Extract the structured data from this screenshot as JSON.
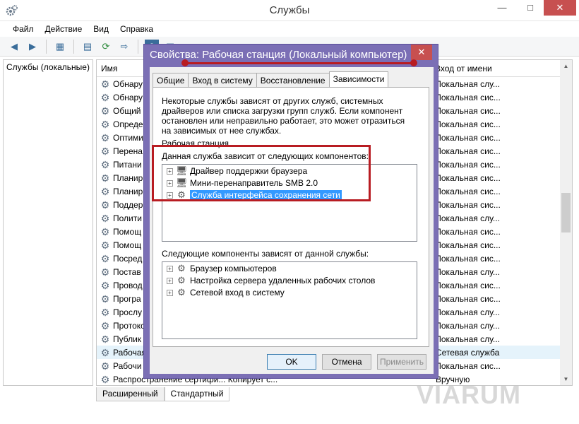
{
  "window": {
    "title": "Службы"
  },
  "menu": [
    "Файл",
    "Действие",
    "Вид",
    "Справка"
  ],
  "tree": {
    "root": "Службы (локальные)"
  },
  "list": {
    "col_name": "Имя",
    "col_logon": "Вход от имени",
    "rows": [
      {
        "name": "Обнару",
        "logon": "Локальная слу..."
      },
      {
        "name": "Обнару",
        "logon": "Локальная сис..."
      },
      {
        "name": "Общий",
        "logon": "Локальная сис..."
      },
      {
        "name": "Опреде",
        "logon": "Локальная сис..."
      },
      {
        "name": "Оптими",
        "logon": "Локальная сис..."
      },
      {
        "name": "Перена",
        "logon": "Локальная сис..."
      },
      {
        "name": "Питани",
        "logon": "Локальная сис..."
      },
      {
        "name": "Планир",
        "logon": "Локальная сис..."
      },
      {
        "name": "Планир",
        "logon": "Локальная сис..."
      },
      {
        "name": "Поддер",
        "logon": "Локальная сис..."
      },
      {
        "name": "Полити",
        "logon": "Локальная слу..."
      },
      {
        "name": "Помощ",
        "logon": "Локальная сис..."
      },
      {
        "name": "Помощ",
        "logon": "Локальная сис..."
      },
      {
        "name": "Посред",
        "logon": "Локальная сис..."
      },
      {
        "name": "Постав",
        "logon": "Локальная слу..."
      },
      {
        "name": "Провод",
        "logon": "Локальная сис..."
      },
      {
        "name": "Програ",
        "logon": "Локальная сис..."
      },
      {
        "name": "Прослу",
        "logon": "Локальная слу..."
      },
      {
        "name": "Протоко",
        "logon": "Локальная слу..."
      },
      {
        "name": "Публик",
        "logon": "Локальная слу..."
      },
      {
        "name": "Рабочая",
        "logon": "Сетевая служба"
      },
      {
        "name": "Рабочи",
        "logon": "Локальная сис..."
      },
      {
        "name": "Распространение сертифи...  Копирует с...",
        "logon": "Вручную"
      }
    ]
  },
  "bottom_tabs": [
    "Расширенный",
    "Стандартный"
  ],
  "watermark": "VIARUM",
  "dialog": {
    "title": "Свойства: Рабочая станция (Локальный компьютер)",
    "tabs": [
      "Общие",
      "Вход в систему",
      "Восстановление",
      "Зависимости"
    ],
    "description": "Некоторые службы зависят от других служб, системных драйверов или списка загрузки групп служб. Если компонент остановлен или неправильно работает, это может отразиться на зависимых от нее службах.",
    "service_name": "Рабочая станция",
    "depends_on_label": "Данная служба зависит от следующих компонентов:",
    "depends_on": [
      "Драйвер поддержки браузера",
      "Мини-перенаправитель SMB 2.0",
      "Служба интерфейса сохранения сети"
    ],
    "dependents_label": "Следующие компоненты зависят от данной службы:",
    "dependents": [
      "Браузер компьютеров",
      "Настройка сервера удаленных рабочих столов",
      "Сетевой вход в систему"
    ],
    "buttons": {
      "ok": "OK",
      "cancel": "Отмена",
      "apply": "Применить"
    }
  }
}
